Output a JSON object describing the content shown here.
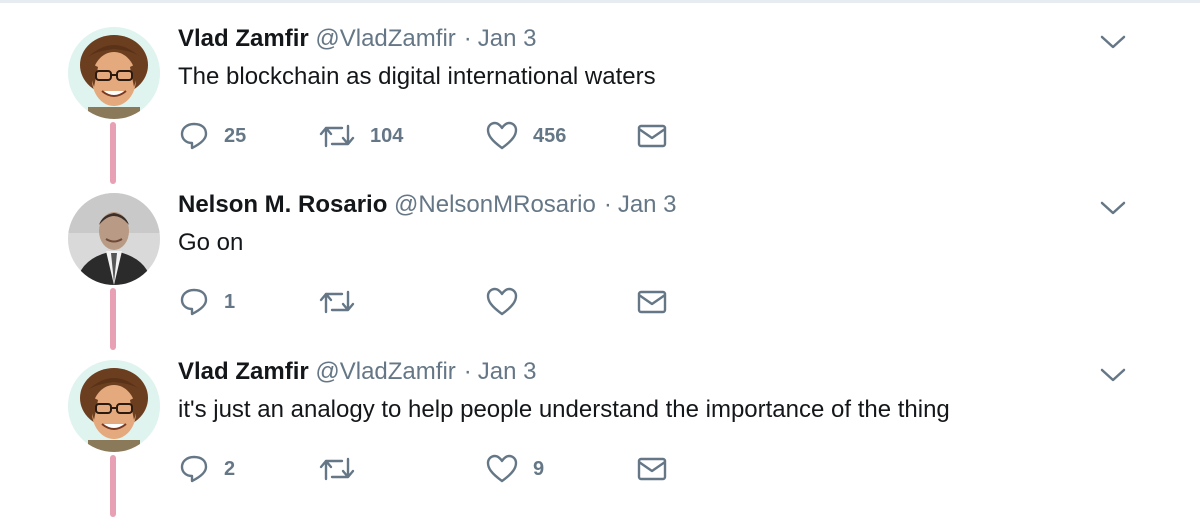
{
  "tweets": [
    {
      "name": "Vlad Zamfir",
      "handle": "@VladZamfir",
      "separator": "·",
      "date": "Jan 3",
      "text": "The blockchain as digital international waters",
      "replies": "25",
      "retweets": "104",
      "likes": "456",
      "avatar_icon": "avatar-vlad",
      "thread_color": "#e8a0b4"
    },
    {
      "name": "Nelson M. Rosario",
      "handle": "@NelsonMRosario",
      "separator": "·",
      "date": "Jan 3",
      "text": "Go on",
      "replies": "1",
      "retweets": "",
      "likes": "",
      "avatar_icon": "avatar-nelson",
      "thread_color": "#e8a0b4"
    },
    {
      "name": "Vlad Zamfir",
      "handle": "@VladZamfir",
      "separator": "·",
      "date": "Jan 3",
      "text": "it's just an analogy to help people understand the importance of the thing",
      "replies": "2",
      "retweets": "",
      "likes": "9",
      "avatar_icon": "avatar-vlad",
      "thread_color": "#e8a0b4"
    }
  ],
  "icons": {
    "reply": "reply-icon",
    "retweet": "retweet-icon",
    "like": "heart-icon",
    "dm": "envelope-icon",
    "menu": "chevron-down-icon"
  },
  "colors": {
    "text": "#14171a",
    "muted": "#657786",
    "thread": "#e8a0b4",
    "divider": "#e6ecf0"
  }
}
